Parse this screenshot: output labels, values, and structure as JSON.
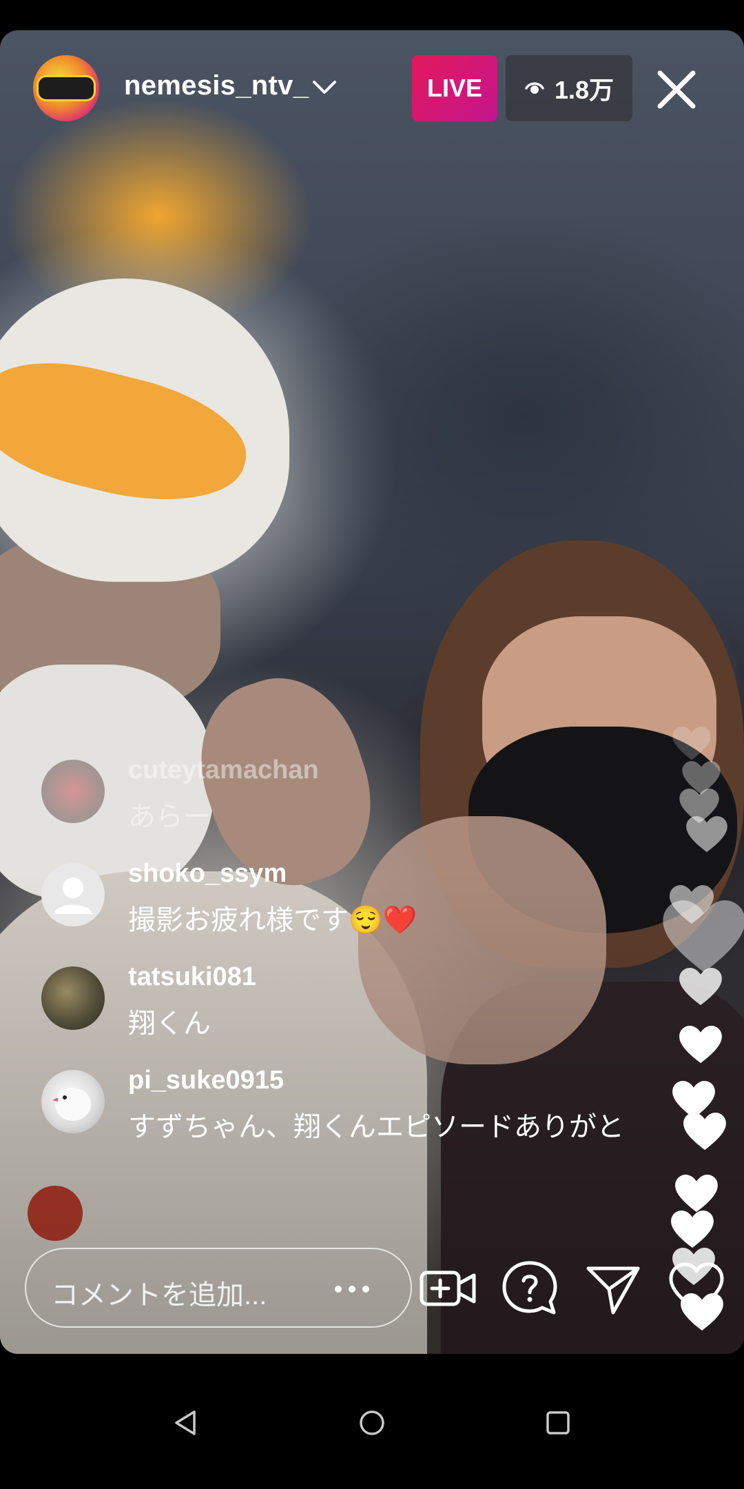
{
  "stream": {
    "username": "nemesis_ntv_",
    "live_label": "LIVE",
    "viewer_count": "1.8万"
  },
  "comments": [
    {
      "user": "cuteytamachan",
      "text": "あらー"
    },
    {
      "user": "shoko_ssym",
      "text": "撮影お疲れ様です😌❤️"
    },
    {
      "user": "tatsuki081",
      "text": "翔くん"
    },
    {
      "user": "pi_suke0915",
      "text": "すずちゃん、翔くんエピソードありがと"
    }
  ],
  "composer": {
    "placeholder": "コメントを追加..."
  },
  "colors": {
    "live_gradient_start": "#e3195b",
    "live_gradient_end": "#c3158f",
    "viewer_pill_bg": "#37393e"
  },
  "icons": {
    "dropdown": "chevron-down-icon",
    "viewers": "eye-icon",
    "close": "close-icon",
    "add_video": "add-video-icon",
    "question": "question-icon",
    "share": "send-icon",
    "like": "heart-icon",
    "nav_back": "back-triangle-icon",
    "nav_home": "home-circle-icon",
    "nav_recents": "recents-square-icon"
  }
}
